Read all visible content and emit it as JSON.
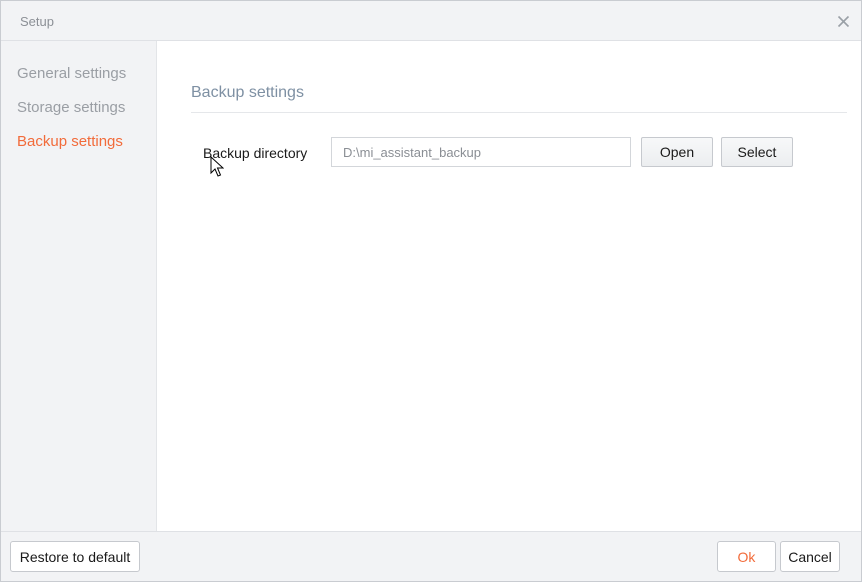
{
  "window": {
    "title": "Setup",
    "close_icon": "close-icon"
  },
  "sidebar": {
    "items": [
      {
        "label": "General settings",
        "active": false
      },
      {
        "label": "Storage settings",
        "active": false
      },
      {
        "label": "Backup settings",
        "active": true
      }
    ]
  },
  "main": {
    "section_title": "Backup settings",
    "backup_directory": {
      "label": "Backup directory",
      "value": "D:\\mi_assistant_backup",
      "open_label": "Open",
      "select_label": "Select"
    }
  },
  "footer": {
    "restore_label": "Restore to default",
    "ok_label": "Ok",
    "cancel_label": "Cancel"
  },
  "colors": {
    "accent": "#f26b3a",
    "section_title": "#7e90a3",
    "sidebar_bg": "#f2f3f5"
  }
}
